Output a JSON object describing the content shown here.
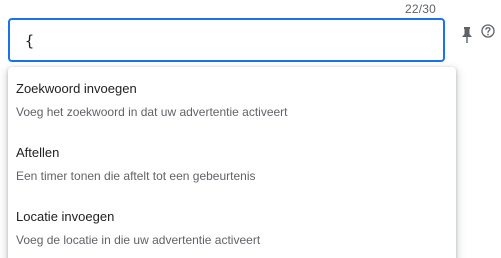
{
  "field": {
    "counter": "22/30",
    "value": "{"
  },
  "icons": {
    "pin": "pin-icon",
    "help": "help-circle-icon"
  },
  "colors": {
    "accent": "#1a73e8",
    "text_primary": "#202124",
    "text_secondary": "#5f6368",
    "icon": "#5f6368"
  },
  "dropdown": {
    "options": [
      {
        "title": "Zoekwoord invoegen",
        "description": "Voeg het zoekwoord in dat uw advertentie activeert"
      },
      {
        "title": "Aftellen",
        "description": "Een timer tonen die aftelt tot een gebeurtenis"
      },
      {
        "title": "Locatie invoegen",
        "description": "Voeg de locatie in die uw advertentie activeert"
      }
    ]
  }
}
